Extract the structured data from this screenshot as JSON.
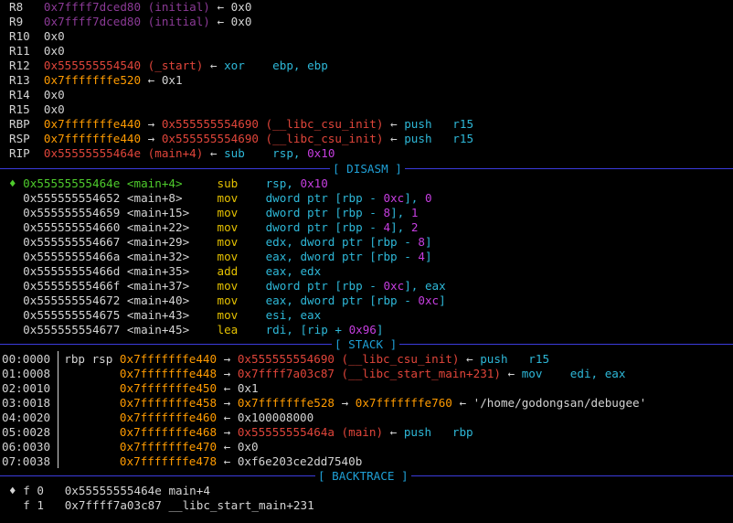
{
  "registers": [
    {
      "name": "R8",
      "parts": [
        [
          "0x7ffff7dced80 (initial) ",
          "p"
        ],
        [
          "← 0x0",
          "w"
        ]
      ]
    },
    {
      "name": "R9",
      "parts": [
        [
          "0x7ffff7dced80 (initial) ",
          "p"
        ],
        [
          "← 0x0",
          "w"
        ]
      ]
    },
    {
      "name": "R10",
      "parts": [
        [
          "0x0",
          "w"
        ]
      ]
    },
    {
      "name": "R11",
      "parts": [
        [
          "0x0",
          "w"
        ]
      ]
    },
    {
      "name": "R12",
      "parts": [
        [
          "0x555555554540 (_start) ",
          "r"
        ],
        [
          "← ",
          "w"
        ],
        [
          "xor    ebp, ebp",
          "c"
        ]
      ]
    },
    {
      "name": "R13",
      "parts": [
        [
          "0x7fffffffe520 ",
          "o"
        ],
        [
          "← 0x1",
          "w"
        ]
      ]
    },
    {
      "name": "R14",
      "parts": [
        [
          "0x0",
          "w"
        ]
      ]
    },
    {
      "name": "R15",
      "parts": [
        [
          "0x0",
          "w"
        ]
      ]
    },
    {
      "name": "RBP",
      "parts": [
        [
          "0x7fffffffe440 ",
          "o"
        ],
        [
          "→ ",
          "w"
        ],
        [
          "0x555555554690 (__libc_csu_init) ",
          "r"
        ],
        [
          "← ",
          "w"
        ],
        [
          "push   r15",
          "c"
        ]
      ]
    },
    {
      "name": "RSP",
      "parts": [
        [
          "0x7fffffffe440 ",
          "o"
        ],
        [
          "→ ",
          "w"
        ],
        [
          "0x555555554690 (__libc_csu_init) ",
          "r"
        ],
        [
          "← ",
          "w"
        ],
        [
          "push   r15",
          "c"
        ]
      ]
    },
    {
      "name": "RIP",
      "parts": [
        [
          "0x55555555464e (main+4) ",
          "r"
        ],
        [
          "← ",
          "w"
        ],
        [
          "sub    rsp, ",
          "c"
        ],
        [
          "0x10",
          "m"
        ]
      ]
    }
  ],
  "sections": {
    "disasm": "[ DISASM ]",
    "stack": "[ STACK ]",
    "backtrace": "[ BACKTRACE ]"
  },
  "disasm": [
    {
      "current": true,
      "marker": "♦",
      "addr": "0x55555555464e",
      "sym": "<main+4>",
      "mn": "sub",
      "ops": [
        [
          "rsp, ",
          "c"
        ],
        [
          "0x10",
          "m"
        ]
      ]
    },
    {
      "addr": "0x555555554652",
      "sym": "<main+8>",
      "mn": "mov",
      "ops": [
        [
          "dword ptr [rbp - ",
          "c"
        ],
        [
          "0xc",
          "m"
        ],
        [
          "], ",
          "c"
        ],
        [
          "0",
          "m"
        ]
      ]
    },
    {
      "addr": "0x555555554659",
      "sym": "<main+15>",
      "mn": "mov",
      "ops": [
        [
          "dword ptr [rbp - ",
          "c"
        ],
        [
          "8",
          "m"
        ],
        [
          "], ",
          "c"
        ],
        [
          "1",
          "m"
        ]
      ]
    },
    {
      "addr": "0x555555554660",
      "sym": "<main+22>",
      "mn": "mov",
      "ops": [
        [
          "dword ptr [rbp - ",
          "c"
        ],
        [
          "4",
          "m"
        ],
        [
          "], ",
          "c"
        ],
        [
          "2",
          "m"
        ]
      ]
    },
    {
      "addr": "0x555555554667",
      "sym": "<main+29>",
      "mn": "mov",
      "ops": [
        [
          "edx, dword ptr [rbp - ",
          "c"
        ],
        [
          "8",
          "m"
        ],
        [
          "]",
          "c"
        ]
      ]
    },
    {
      "addr": "0x55555555466a",
      "sym": "<main+32>",
      "mn": "mov",
      "ops": [
        [
          "eax, dword ptr [rbp - ",
          "c"
        ],
        [
          "4",
          "m"
        ],
        [
          "]",
          "c"
        ]
      ]
    },
    {
      "addr": "0x55555555466d",
      "sym": "<main+35>",
      "mn": "add",
      "ops": [
        [
          "eax, edx",
          "c"
        ]
      ]
    },
    {
      "addr": "0x55555555466f",
      "sym": "<main+37>",
      "mn": "mov",
      "ops": [
        [
          "dword ptr [rbp - ",
          "c"
        ],
        [
          "0xc",
          "m"
        ],
        [
          "], eax",
          "c"
        ]
      ]
    },
    {
      "addr": "0x555555554672",
      "sym": "<main+40>",
      "mn": "mov",
      "ops": [
        [
          "eax, dword ptr [rbp - ",
          "c"
        ],
        [
          "0xc",
          "m"
        ],
        [
          "]",
          "c"
        ]
      ]
    },
    {
      "addr": "0x555555554675",
      "sym": "<main+43>",
      "mn": "mov",
      "ops": [
        [
          "esi, eax",
          "c"
        ]
      ]
    },
    {
      "addr": "0x555555554677",
      "sym": "<main+45>",
      "mn": "lea",
      "ops": [
        [
          "rdi, [rip + ",
          "c"
        ],
        [
          "0x96",
          "m"
        ],
        [
          "]",
          "c"
        ]
      ]
    }
  ],
  "stack": [
    {
      "off": "00:0000",
      "regs": "rbp rsp ",
      "parts": [
        [
          "0x7fffffffe440 ",
          "o"
        ],
        [
          "→ ",
          "w"
        ],
        [
          "0x555555554690 (__libc_csu_init) ",
          "r"
        ],
        [
          "← ",
          "w"
        ],
        [
          "push   r15",
          "c"
        ]
      ]
    },
    {
      "off": "01:0008",
      "regs": "        ",
      "parts": [
        [
          "0x7fffffffe448 ",
          "o"
        ],
        [
          "→ ",
          "w"
        ],
        [
          "0x7ffff7a03c87 (__libc_start_main+231) ",
          "r"
        ],
        [
          "← ",
          "w"
        ],
        [
          "mov    edi, eax",
          "c"
        ]
      ]
    },
    {
      "off": "02:0010",
      "regs": "        ",
      "parts": [
        [
          "0x7fffffffe450 ",
          "o"
        ],
        [
          "← 0x1",
          "w"
        ]
      ]
    },
    {
      "off": "03:0018",
      "regs": "        ",
      "parts": [
        [
          "0x7fffffffe458 ",
          "o"
        ],
        [
          "→ ",
          "w"
        ],
        [
          "0x7fffffffe528 ",
          "o"
        ],
        [
          "→ ",
          "w"
        ],
        [
          "0x7fffffffe760 ",
          "o"
        ],
        [
          "← '/home/godongsan/debugee'",
          "w"
        ]
      ]
    },
    {
      "off": "04:0020",
      "regs": "        ",
      "parts": [
        [
          "0x7fffffffe460 ",
          "o"
        ],
        [
          "← 0x100008000",
          "w"
        ]
      ]
    },
    {
      "off": "05:0028",
      "regs": "        ",
      "parts": [
        [
          "0x7fffffffe468 ",
          "o"
        ],
        [
          "→ ",
          "w"
        ],
        [
          "0x55555555464a (main) ",
          "r"
        ],
        [
          "← ",
          "w"
        ],
        [
          "push   rbp",
          "c"
        ]
      ]
    },
    {
      "off": "06:0030",
      "regs": "        ",
      "parts": [
        [
          "0x7fffffffe470 ",
          "o"
        ],
        [
          "← 0x0",
          "w"
        ]
      ]
    },
    {
      "off": "07:0038",
      "regs": "        ",
      "parts": [
        [
          "0x7fffffffe478 ",
          "o"
        ],
        [
          "← 0xf6e203ce2dd7540b",
          "w"
        ]
      ]
    }
  ],
  "backtrace": [
    {
      "marker": "♦",
      "frame": "f 0",
      "addr": "0x55555555464e",
      "sym": "main+4"
    },
    {
      "marker": " ",
      "frame": "f 1",
      "addr": "0x7ffff7a03c87",
      "sym": "__libc_start_main+231"
    }
  ],
  "colors": {
    "bg": "#000000",
    "text": "#d4d4d4",
    "purple": "#8b3a96",
    "red": "#e0453a",
    "yellow": "#e5c100",
    "orange": "#ff9b00",
    "cyan": "#2eb8d8",
    "magenta": "#c63ee0",
    "green": "#4ecb2c",
    "blue_rule": "#3b3bdc",
    "section_label": "#1fa0d6"
  }
}
